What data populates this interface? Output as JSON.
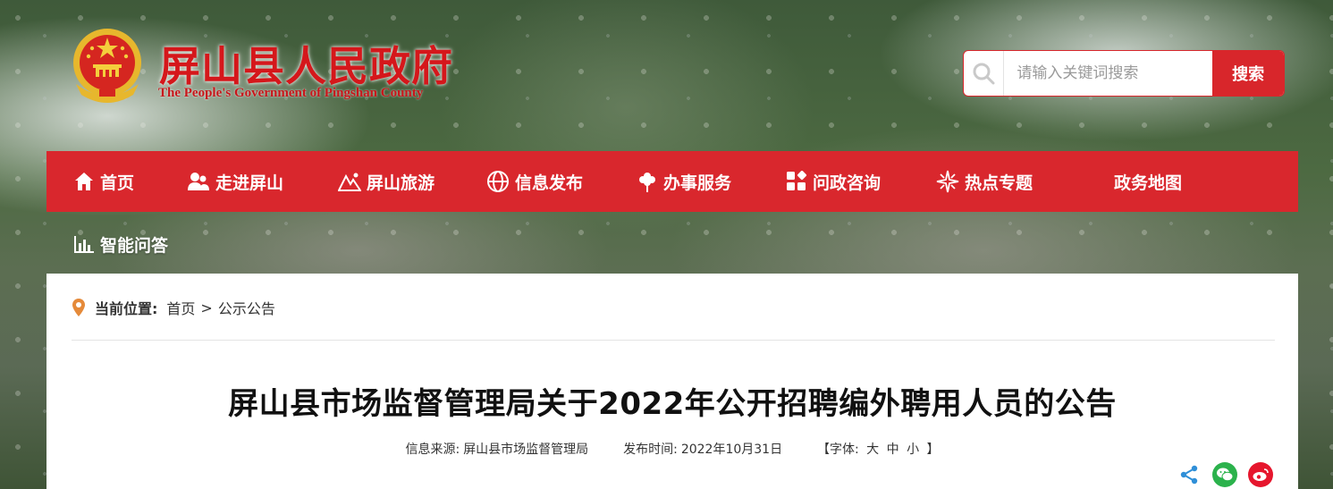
{
  "header": {
    "title": "屏山县人民政府",
    "subtitle": "The People's Government of Pingshan County",
    "emblem_icon": "national-emblem-icon"
  },
  "search": {
    "placeholder": "请输入关键词搜索",
    "button_label": "搜索"
  },
  "nav": {
    "items": [
      {
        "label": "首页",
        "icon": "home-icon"
      },
      {
        "label": "走进屏山",
        "icon": "people-icon"
      },
      {
        "label": "屏山旅游",
        "icon": "mountain-icon"
      },
      {
        "label": "信息发布",
        "icon": "globe-icon"
      },
      {
        "label": "办事服务",
        "icon": "flower-icon"
      },
      {
        "label": "问政咨询",
        "icon": "grid-icon"
      },
      {
        "label": "热点专题",
        "icon": "sparkle-icon"
      },
      {
        "label": "政务地图",
        "icon": ""
      },
      {
        "label": "智能问答",
        "icon": "bar-chart-icon"
      }
    ]
  },
  "breadcrumb": {
    "label": "当前位置:",
    "items": [
      "首页",
      "公示公告"
    ],
    "separator": ">"
  },
  "article": {
    "title": "屏山县市场监督管理局关于2022年公开招聘编外聘用人员的公告",
    "source_label": "信息来源:",
    "source": "屏山县市场监督管理局",
    "date_label": "发布时间:",
    "date": "2022年10月31日",
    "font_open": "【字体:",
    "font_large": "大",
    "font_medium": "中",
    "font_small": "小",
    "font_close": "】"
  },
  "colors": {
    "brand_red": "#d9272d",
    "wechat_green": "#2bb24c",
    "weibo_red": "#e6162d",
    "share_blue": "#2f8fd8"
  }
}
